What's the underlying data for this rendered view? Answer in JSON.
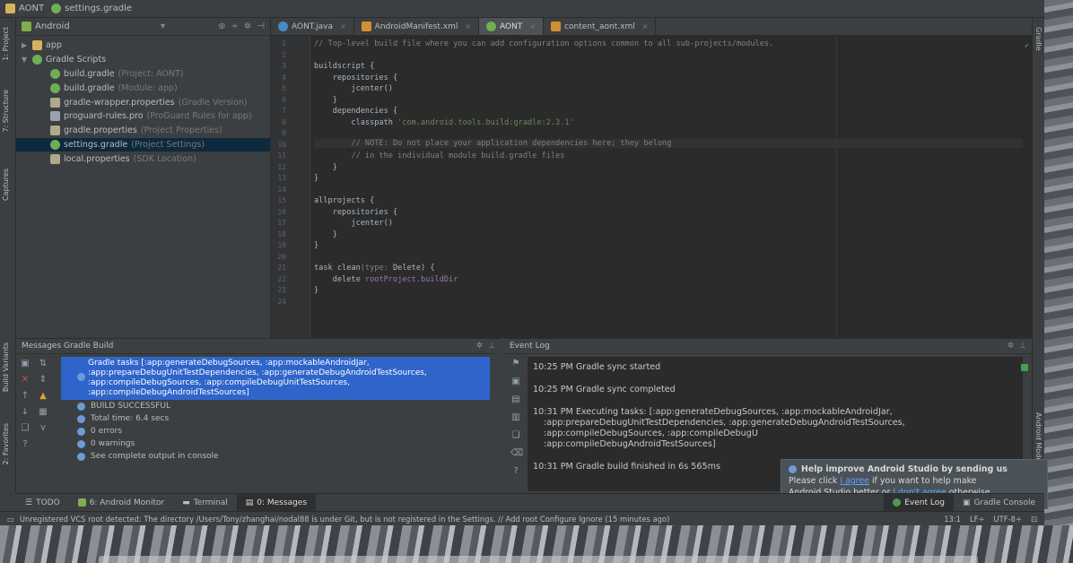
{
  "navbar": {
    "project": "AONT",
    "file": "settings.gradle"
  },
  "left_stripe": {
    "project": "1: Project",
    "structure": "7: Structure",
    "captures": "Captures",
    "build_variants": "Build Variants",
    "favorites": "2: Favorites"
  },
  "right_stripe": {
    "gradle": "Gradle",
    "android_model": "Android Model"
  },
  "project_panel": {
    "view": "Android",
    "tree": [
      {
        "label": "app",
        "hint": ""
      },
      {
        "label": "Gradle Scripts",
        "hint": ""
      },
      {
        "label": "build.gradle",
        "hint": "(Project: AONT)"
      },
      {
        "label": "build.gradle",
        "hint": "(Module: app)"
      },
      {
        "label": "gradle-wrapper.properties",
        "hint": "(Gradle Version)"
      },
      {
        "label": "proguard-rules.pro",
        "hint": "(ProGuard Rules for app)"
      },
      {
        "label": "gradle.properties",
        "hint": "(Project Properties)"
      },
      {
        "label": "settings.gradle",
        "hint": "(Project Settings)"
      },
      {
        "label": "local.properties",
        "hint": "(SDK Location)"
      }
    ]
  },
  "editor_tabs": [
    "AONT.java",
    "AndroidManifest.xml",
    "AONT",
    "content_aont.xml"
  ],
  "code": {
    "line_numbers": [
      "1",
      "2",
      "3",
      "4",
      "5",
      "6",
      "7",
      "8",
      "9",
      "10",
      "11",
      "12",
      "13",
      "14",
      "15",
      "16",
      "17",
      "18",
      "19",
      "20",
      "21",
      "22",
      "23",
      "24"
    ],
    "l1": "// Top-level build file where you can add configuration options common to all sub-projects/modules.",
    "l3": "buildscript {",
    "l4": "    repositories {",
    "l5": "        jcenter()",
    "l6": "    }",
    "l7": "    dependencies {",
    "l8a": "        classpath ",
    "l8b": "'com.android.tools.build:gradle:2.3.1'",
    "l10": "        // NOTE: Do not place your application dependencies here; they belong",
    "l11": "        // in the individual module build.gradle files",
    "l12": "    }",
    "l13": "}",
    "l15": "allprojects {",
    "l16": "    repositories {",
    "l17": "        jcenter()",
    "l18": "    }",
    "l19": "}",
    "l21a": "task clean",
    "l21b": "(type: ",
    "l21c": "Delete) {",
    "l22a": "    delete ",
    "l22b": "rootProject.buildDir",
    "l23": "}"
  },
  "messages": {
    "title": "Messages Gradle Build",
    "selected": [
      "Gradle tasks [:app:generateDebugSources, :app:mockableAndroidJar,",
      ":app:prepareDebugUnitTestDependencies, :app:generateDebugAndroidTestSources,",
      ":app:compileDebugSources, :app:compileDebugUnitTestSources,",
      ":app:compileDebugAndroidTestSources]"
    ],
    "rows": [
      "BUILD SUCCESSFUL",
      "Total time: 6.4 secs",
      "0 errors",
      "0 warnings",
      "See complete output in console"
    ]
  },
  "event_log": {
    "title": "Event Log",
    "entries": [
      {
        "time": "10:25 PM",
        "text": "Gradle sync started"
      },
      {
        "time": "10:25 PM",
        "text": "Gradle sync completed"
      },
      {
        "time": "10:31 PM",
        "text": "Executing tasks: [:app:generateDebugSources, :app:mockableAndroidJar,",
        "cont": [
          ":app:prepareDebugUnitTestDependencies, :app:generateDebugAndroidTestSources,",
          ":app:compileDebugSources, :app:compileDebugU",
          ":app:compileDebugAndroidTestSources]"
        ]
      },
      {
        "time": "10:31 PM",
        "text": "Gradle build finished in 6s 565ms"
      }
    ],
    "balloon": {
      "title": "Help improve Android Studio by sending us",
      "line1a": "Please click ",
      "agree": "I agree",
      "line1b": " if you want to help make",
      "line2a": "Android Studio better or ",
      "disagree": "I don't agree",
      "line2b": " otherwise."
    }
  },
  "tool_tabs": {
    "todo": "TODO",
    "android_monitor": "6: Android Monitor",
    "terminal": "Terminal",
    "messages": "0: Messages",
    "event_log": "Event Log",
    "gradle_console": "Gradle Console"
  },
  "status": {
    "message": "Unregistered VCS root detected: The directory /Users/Tony/zhanghai/nodal88 is under Git, but is not registered in the Settings. // Add root  Configure  Ignore (15 minutes ago)",
    "position": "13:1",
    "line_sep": "LF÷",
    "encoding": "UTF-8÷"
  }
}
